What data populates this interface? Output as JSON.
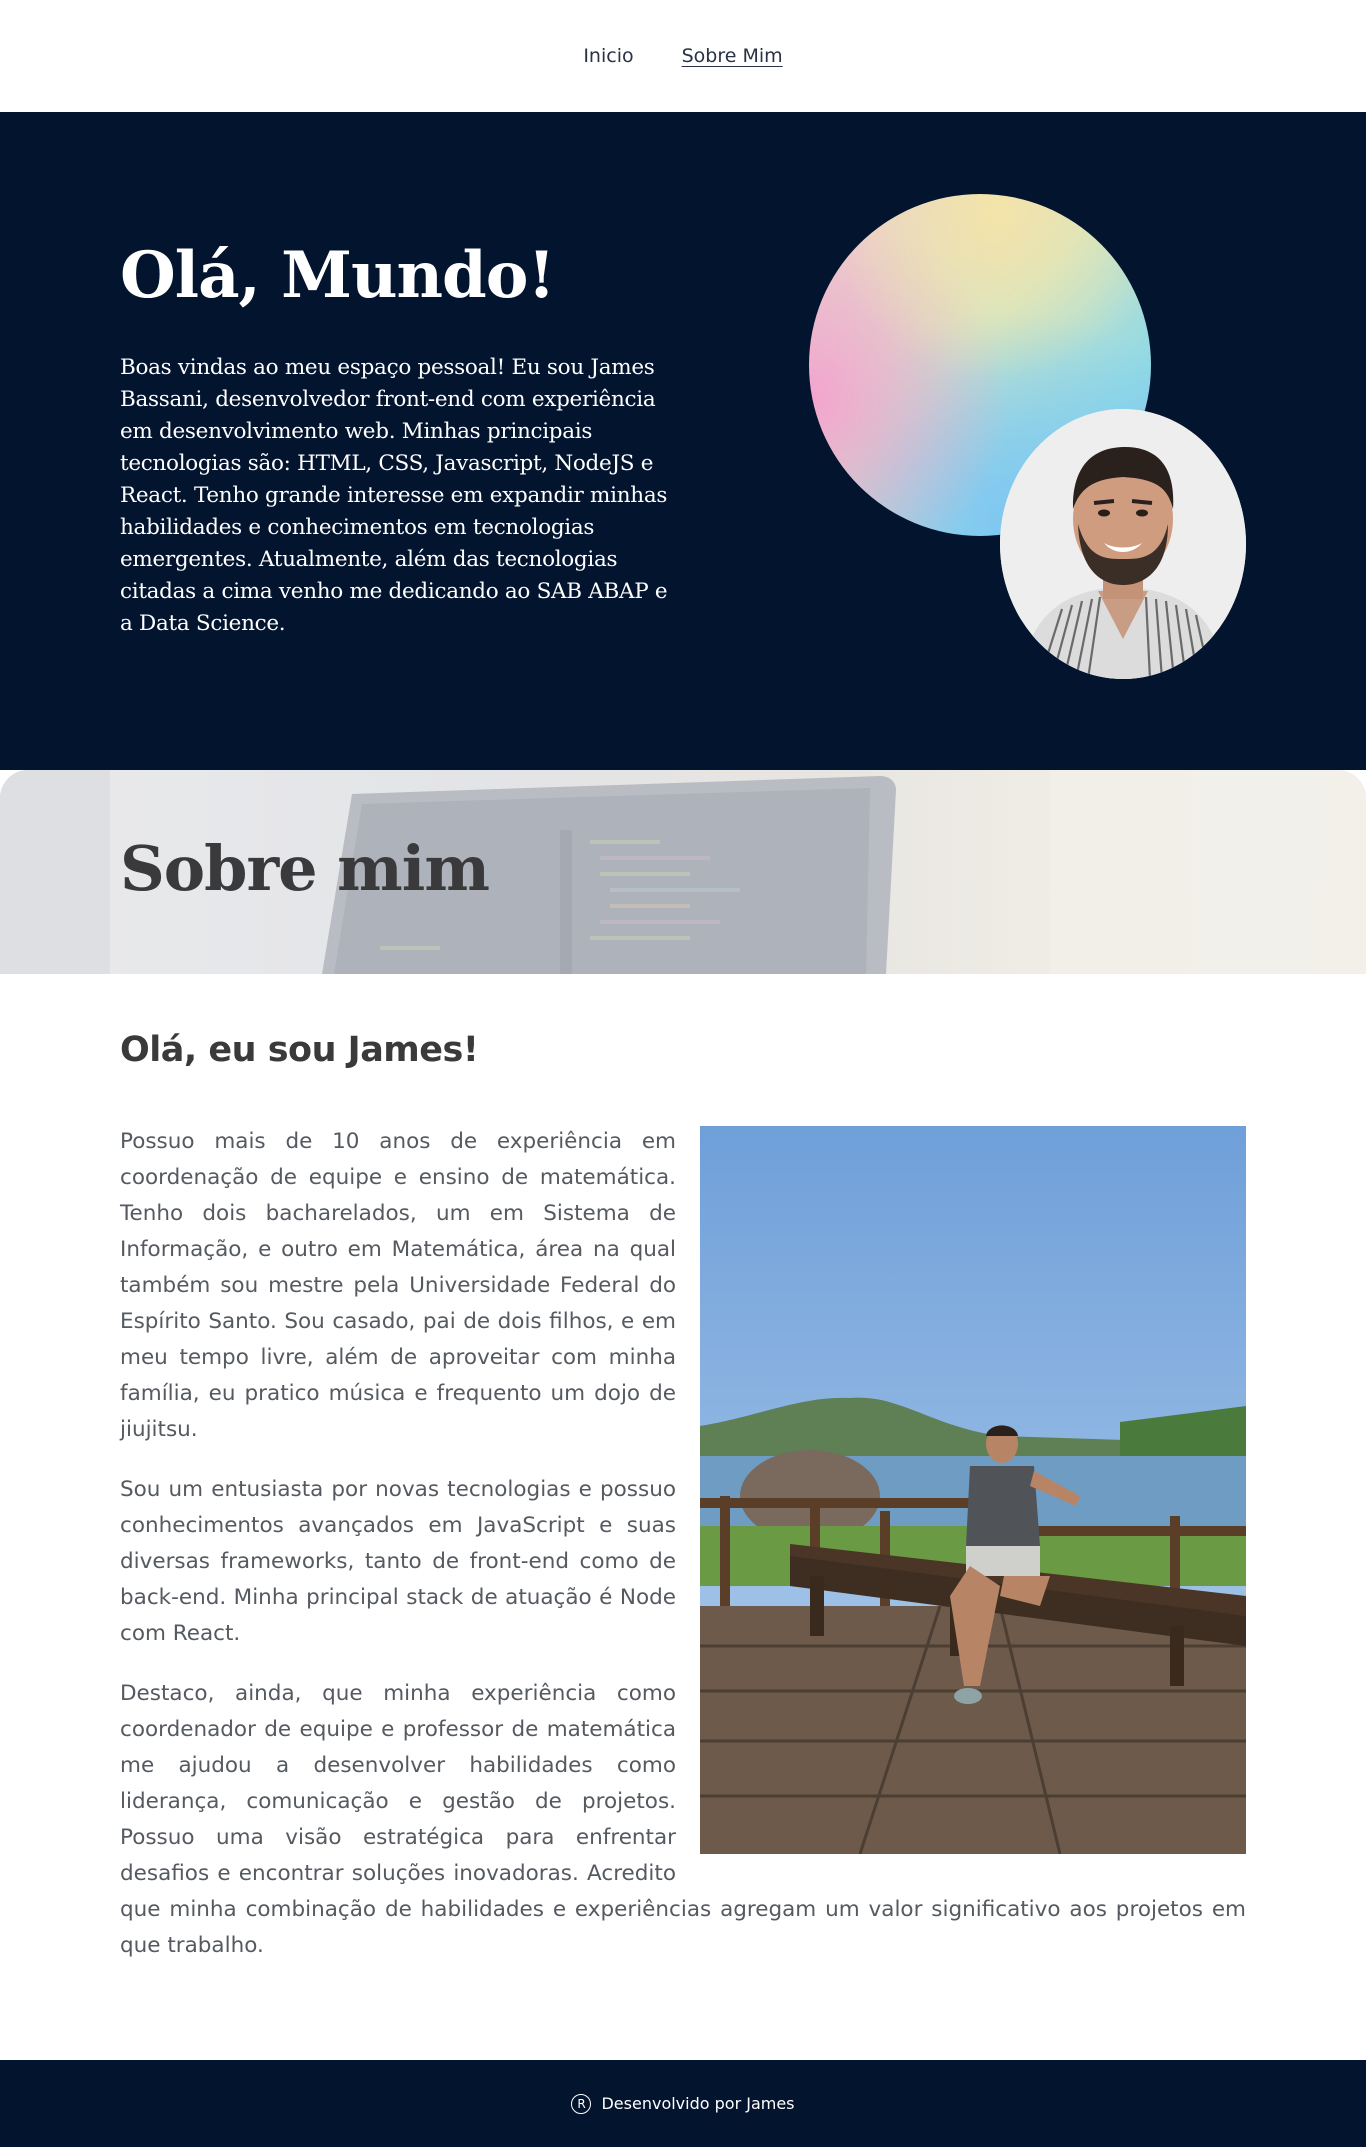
{
  "nav": {
    "items": [
      {
        "label": "Inicio",
        "active": false
      },
      {
        "label": "Sobre Mim",
        "active": true
      }
    ]
  },
  "hero": {
    "title": "Olá, Mundo!",
    "text": "Boas vindas ao meu espaço pessoal! Eu sou James Bassani, desenvolvedor front-end com experiência em desenvolvimento web. Minhas principais tecnologias são: HTML, CSS, Javascript, NodeJS e React. Tenho grande interesse em expandir minhas habilidades e conhecimentos em tecnologias emergentes. Atualmente, além das tecnologias citadas a cima venho me dedicando ao SAB ABAP e a Data Science."
  },
  "about": {
    "banner_title": "Sobre mim",
    "greeting": "Olá, eu sou James!",
    "paragraphs": [
      "Possuo mais de 10 anos de experiência em coordenação de equipe e ensino de matemática. Tenho dois bacharelados, um em Sistema de Informação, e outro em Matemática, área na qual também sou mestre pela Universidade Federal do Espírito Santo. Sou casado, pai de dois filhos, e em meu tempo livre, além de aproveitar com minha família, eu pratico música e frequento um dojo de jiujitsu.",
      "Sou um entusiasta por novas tecnologias e possuo conhecimentos avançados em JavaScript e suas diversas frameworks, tanto de front-end como de back-end. Minha principal stack de atuação é Node com React.",
      "Destaco, ainda, que minha experiência como coordenador de equipe e professor de matemática me ajudou a desenvolver habilidades como liderança, comunicação e gestão de projetos. Possuo uma visão estratégica para enfrentar desafios e encontrar soluções inovadoras. Acredito que minha combinação de habilidades e experiências agregam um valor significativo aos projetos em que trabalho."
    ]
  },
  "footer": {
    "icon": "registered-icon",
    "icon_glyph": "R",
    "text": "Desenvolvido por James"
  }
}
